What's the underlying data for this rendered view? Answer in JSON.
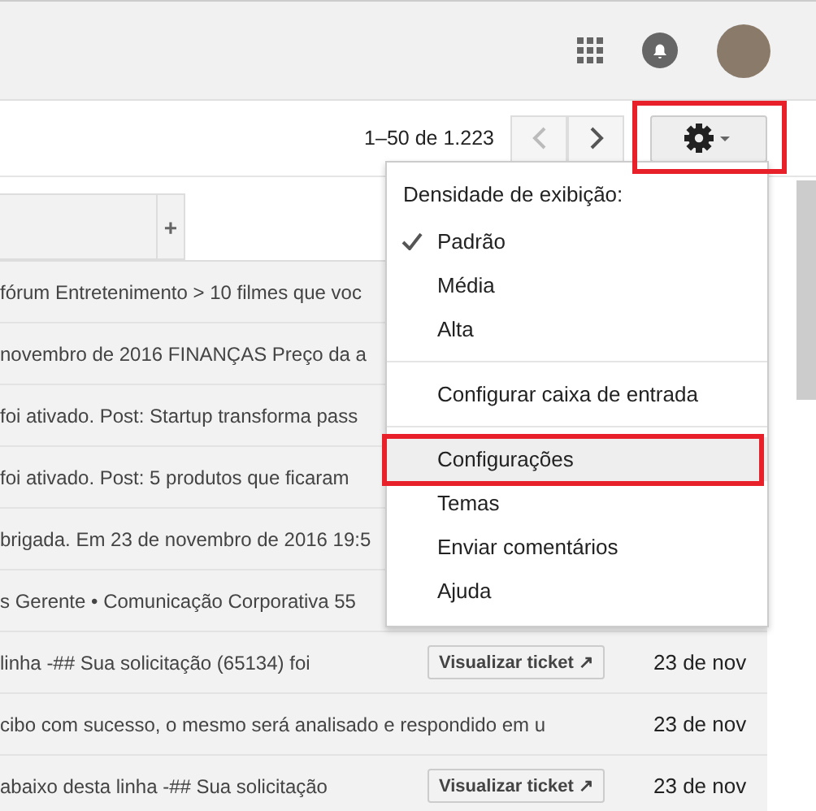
{
  "toolbar": {
    "pagination": "1–50 de 1.223",
    "prev_disabled": true,
    "next_disabled": false
  },
  "tabs": {
    "add_label": "+"
  },
  "messages": [
    {
      "snippet": "fórum Entretenimento > 10 filmes que voc"
    },
    {
      "snippet": "novembro de 2016 FINANÇAS Preço da a"
    },
    {
      "snippet": "foi ativado. Post: Startup transforma pass"
    },
    {
      "snippet": "foi ativado. Post: 5 produtos que ficaram"
    },
    {
      "snippet": "brigada. Em 23 de novembro de 2016 19:5"
    },
    {
      "snippet": "s Gerente • Comunicação Corporativa 55"
    },
    {
      "snippet": "linha -## Sua solicitação (65134) foi",
      "date": "23 de nov",
      "button": "Visualizar ticket ↗"
    },
    {
      "snippet": "cibo com sucesso, o mesmo será analisado e respondido em u",
      "date": "23 de nov"
    },
    {
      "snippet": "abaixo desta linha -## Sua solicitação",
      "date": "23 de nov",
      "button": "Visualizar ticket ↗"
    }
  ],
  "menu": {
    "heading": "Densidade de exibição:",
    "groups": [
      [
        {
          "label": "Padrão",
          "checked": true,
          "selected": false
        },
        {
          "label": "Média",
          "checked": false,
          "selected": false
        },
        {
          "label": "Alta",
          "checked": false,
          "selected": false
        }
      ],
      [
        {
          "label": "Configurar caixa de entrada",
          "checked": false,
          "selected": false
        }
      ],
      [
        {
          "label": "Configurações",
          "checked": false,
          "selected": true
        },
        {
          "label": "Temas",
          "checked": false,
          "selected": false
        },
        {
          "label": "Enviar comentários",
          "checked": false,
          "selected": false
        },
        {
          "label": "Ajuda",
          "checked": false,
          "selected": false
        }
      ]
    ]
  },
  "highlights": {
    "settings_button": true,
    "selected_item": true
  }
}
